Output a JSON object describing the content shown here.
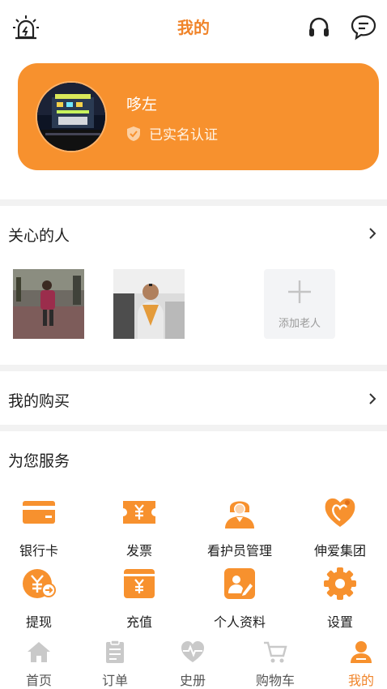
{
  "header": {
    "title": "我的",
    "alarm_icon": "alarm-light-icon",
    "headset_icon": "headset-icon",
    "chat_icon": "chat-bubble-icon"
  },
  "profile": {
    "name": "哆左",
    "verified_text": "已实名认证"
  },
  "care": {
    "label": "关心的人",
    "add_label": "添加老人"
  },
  "purchase": {
    "label": "我的购买"
  },
  "services": {
    "title": "为您服务",
    "items": [
      {
        "label": "银行卡",
        "icon": "bank-card-icon"
      },
      {
        "label": "发票",
        "icon": "invoice-icon"
      },
      {
        "label": "看护员管理",
        "icon": "caregiver-icon"
      },
      {
        "label": "伸爱集团",
        "icon": "group-logo-icon"
      },
      {
        "label": "提现",
        "icon": "withdraw-icon"
      },
      {
        "label": "充值",
        "icon": "recharge-icon"
      },
      {
        "label": "个人资料",
        "icon": "profile-edit-icon"
      },
      {
        "label": "设置",
        "icon": "gear-icon"
      }
    ]
  },
  "tabbar": {
    "items": [
      {
        "label": "首页",
        "icon": "home-icon"
      },
      {
        "label": "订单",
        "icon": "order-icon"
      },
      {
        "label": "史册",
        "icon": "heartbeat-icon"
      },
      {
        "label": "购物车",
        "icon": "cart-icon"
      },
      {
        "label": "我的",
        "icon": "person-icon",
        "active": true
      }
    ]
  },
  "colors": {
    "accent": "#f7912e",
    "title": "#f0842a",
    "divider": "#f2f2f2",
    "inactive_tab": "#c9c9c9"
  }
}
